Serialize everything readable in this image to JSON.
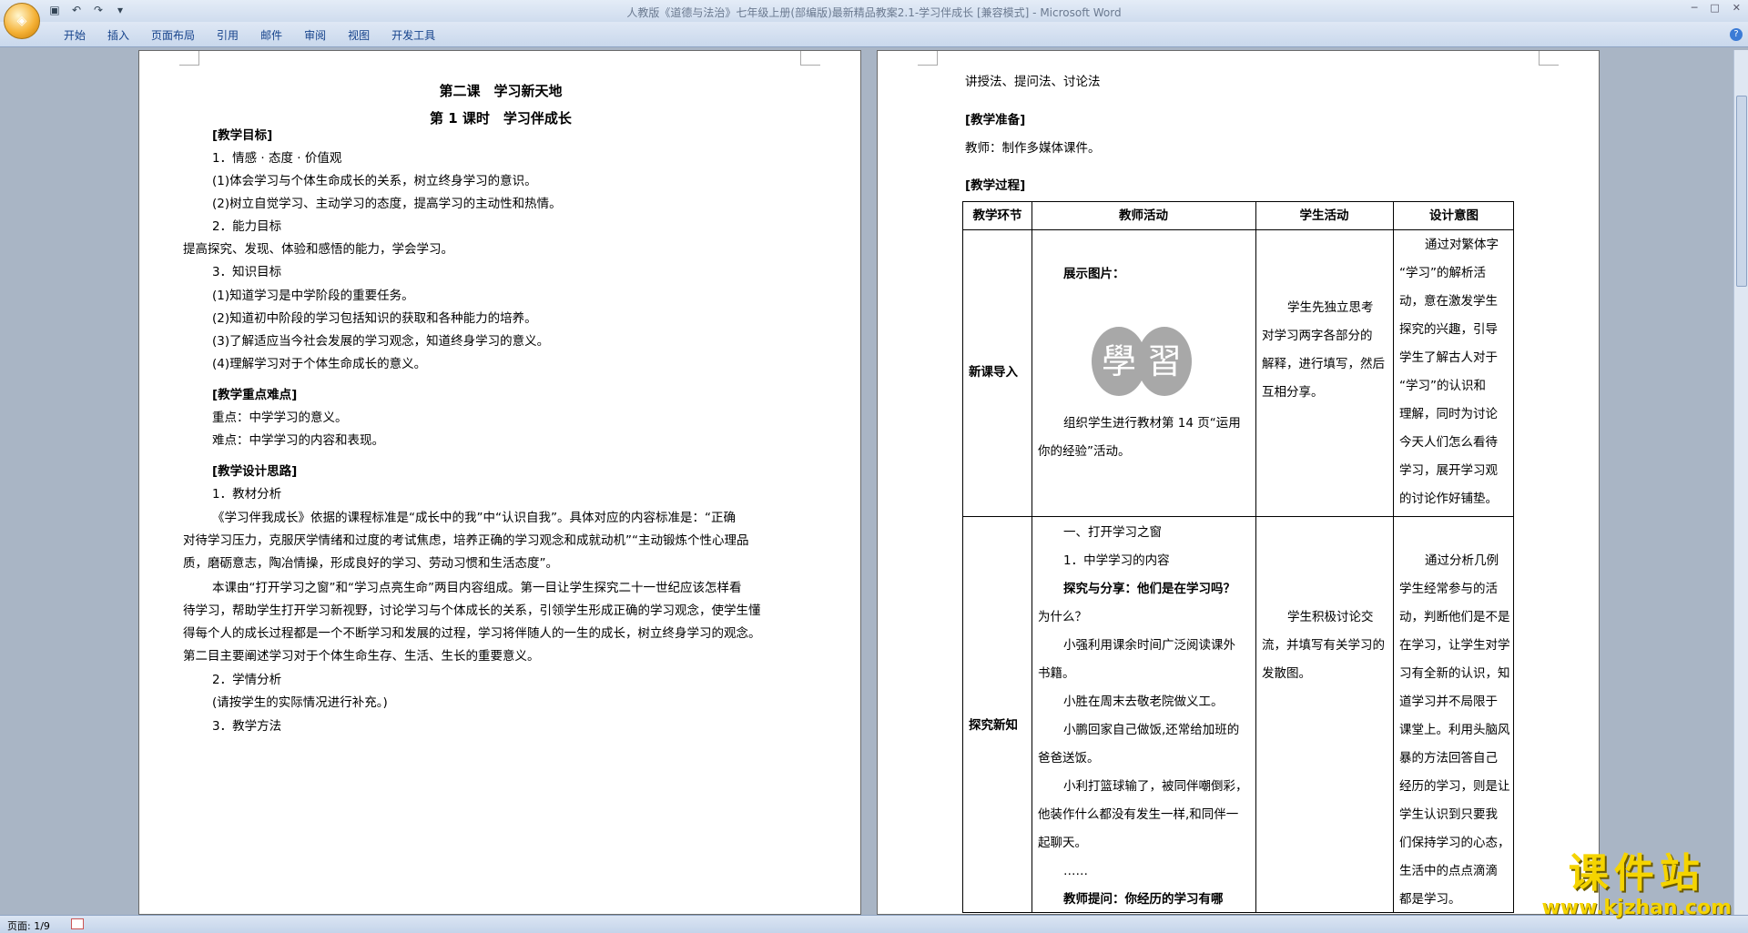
{
  "app": {
    "title": "人教版《道德与法治》七年级上册(部编版)最新精品教案2.1-学习伴成长 [兼容模式] - Microsoft Word",
    "qat_icons": [
      "save-icon",
      "undo-icon",
      "redo-icon",
      "customize-icon"
    ],
    "office_icon": "office-logo"
  },
  "ribbon": {
    "tabs": [
      "开始",
      "插入",
      "页面布局",
      "引用",
      "邮件",
      "审阅",
      "视图",
      "开发工具"
    ]
  },
  "page1": {
    "title1": "第二课　学习新天地",
    "title2": "第 1 课时　学习伴成长",
    "lines": [
      "[教学目标]",
      "1．情感 · 态度 · 价值观",
      "(1)体会学习与个体生命成长的关系，树立终身学习的意识。",
      "(2)树立自觉学习、主动学习的态度，提高学习的主动性和热情。",
      "2．能力目标",
      "提高探究、发现、体验和感悟的能力，学会学习。",
      "3．知识目标",
      "(1)知道学习是中学阶段的重要任务。",
      "(2)知道初中阶段的学习包括知识的获取和各种能力的培养。",
      "(3)了解适应当今社会发展的学习观念，知道终身学习的意义。",
      "(4)理解学习对于个体生命成长的意义。",
      "[教学重点难点]",
      "重点：中学学习的意义。",
      "难点：中学学习的内容和表现。",
      "[教学设计思路]",
      "1．教材分析",
      "《学习伴我成长》依据的课程标准是“成长中的我”中“认识自我”。具体对应的内容标准是：“正确",
      "对待学习压力，克服厌学情绪和过度的考试焦虑，培养正确的学习观念和成就动机”“主动锻炼个性心理品",
      "质，磨砺意志，陶冶情操，形成良好的学习、劳动习惯和生活态度”。",
      "本课由“打开学习之窗”和“学习点亮生命”两目内容组成。第一目让学生探究二十一世纪应该怎样看",
      "待学习，帮助学生打开学习新视野，讨论学习与个体成长的关系，引领学生形成正确的学习观念，使学生懂",
      "得每个人的成长过程都是一个不断学习和发展的过程，学习将伴随人的一生的成长，树立终身学习的观念。",
      "第二目主要阐述学习对于个体生命生存、生活、生长的重要意义。",
      "2．学情分析",
      "(请按学生的实际情况进行补充。)",
      "3．教学方法"
    ]
  },
  "page2": {
    "line1": "讲授法、提问法、讨论法",
    "prep_head": "[教学准备]",
    "prep": "教师：制作多媒体课件。",
    "proc_head": "[教学过程]",
    "table": {
      "headers": [
        "教学环节",
        "教师活动",
        "学生活动",
        "设计意图"
      ],
      "row1": {
        "stage": "新课导入",
        "teacher": [
          "展示图片：",
          "组织学生进行教材第 14 页“运用",
          "你的经验”活动。"
        ],
        "seal_text": [
          "學",
          "習"
        ],
        "student": [
          "学生先独立思考",
          "对学习两字各部分的",
          "解释，进行填写，然后",
          "互相分享。"
        ],
        "intent": [
          "通过对繁体字",
          "“学习”的解析活",
          "动，意在激发学生",
          "探究的兴趣，引导",
          "学生了解古人对于",
          "“学习”的认识和",
          "理解，同时为讨论",
          "今天人们怎么看待",
          "学习，展开学习观",
          "的讨论作好铺垫。"
        ]
      },
      "row2": {
        "stage": "探究新知",
        "teacher": [
          "一、打开学习之窗",
          "1．中学学习的内容",
          "探究与分享：他们是在学习吗？",
          "为什么？",
          "小强利用课余时间广泛阅读课外",
          "书籍。",
          "小胜在周末去敬老院做义工。",
          "小鹏回家自己做饭,还常给加班的",
          "爸爸送饭。",
          "小利打篮球输了，被同伴嘲倒彩，",
          "他装作什么都没有发生一样,和同伴一",
          "起聊天。",
          "……",
          "教师提问：你经历的学习有哪"
        ],
        "student": [
          "学生积极讨论交",
          "流，并填写有关学习的",
          "发散图。"
        ],
        "intent": [
          "通过分析几例",
          "学生经常参与的活",
          "动，判断他们是不是",
          "在学习，让学生对学",
          "习有全新的认识，知",
          "道学习并不局限于",
          "课堂上。利用头脑风",
          "暴的方法回答自己",
          "经历的学习，则是让",
          "学生认识到只要我",
          "们保持学习的心态，",
          "生活中的点点滴滴",
          "都是学习。"
        ]
      }
    }
  },
  "status": {
    "page": "页面: 1/9"
  },
  "watermark": {
    "title": "课件站",
    "url": "www.kjzhan.com",
    "title_color": "#f5d400",
    "url_color": "#f5d400"
  }
}
